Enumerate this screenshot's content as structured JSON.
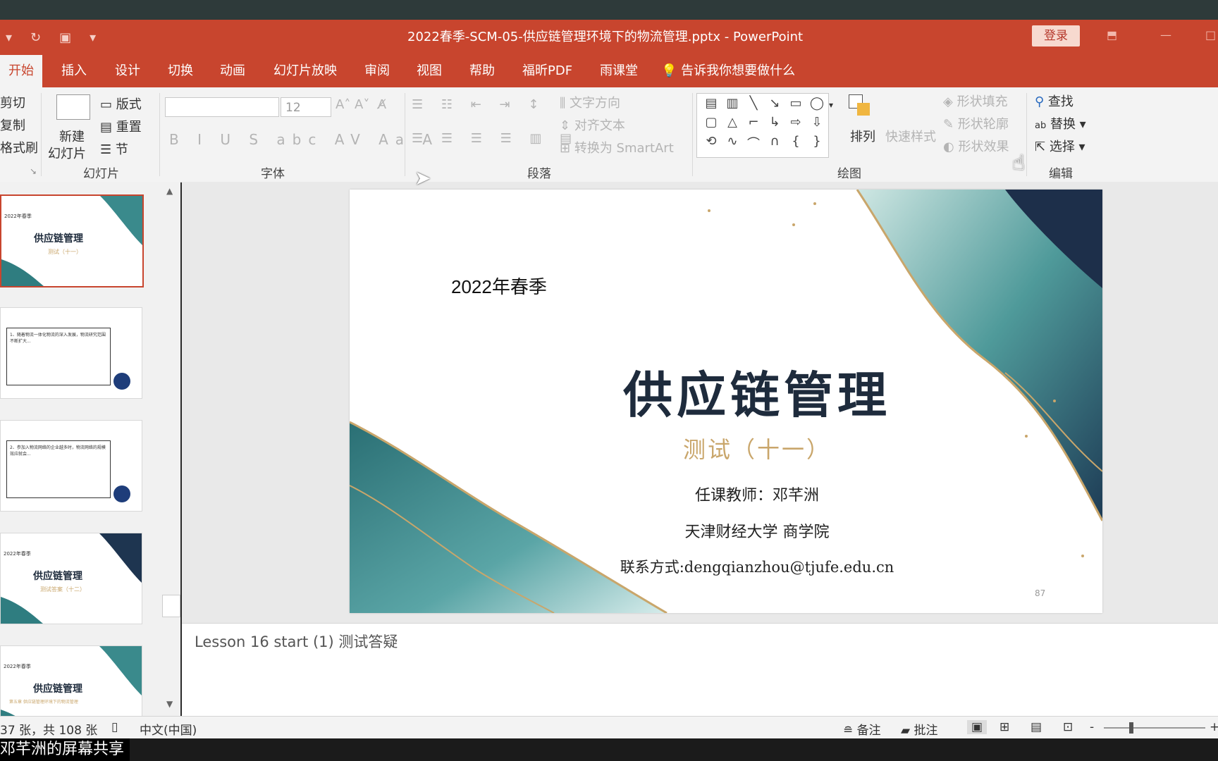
{
  "window": {
    "title": "2022春季-SCM-05-供应链管理环境下的物流管理.pptx  -  PowerPoint",
    "login_label": "登录"
  },
  "tabs": [
    "开始",
    "插入",
    "设计",
    "切换",
    "动画",
    "幻灯片放映",
    "审阅",
    "视图",
    "帮助",
    "福昕PDF",
    "雨课堂"
  ],
  "tellme": "告诉我你想要做什么",
  "ribbon": {
    "clipboard": {
      "cut": "剪切",
      "copy": "复制",
      "format_painter": "格式刷"
    },
    "slides": {
      "new_slide_1": "新建",
      "new_slide_2": "幻灯片",
      "layout": "版式",
      "reset": "重置",
      "section": "节",
      "group": "幻灯片"
    },
    "font": {
      "size": "12",
      "group": "字体"
    },
    "paragraph": {
      "text_direction": "文字方向",
      "align_text": "对齐文本",
      "smartart": "转换为 SmartArt",
      "group": "段落"
    },
    "drawing": {
      "arrange": "排列",
      "quick_styles": "快速样式",
      "shape_fill": "形状填充",
      "shape_outline": "形状轮廓",
      "shape_effects": "形状效果",
      "group": "绘图"
    },
    "editing": {
      "find": "查找",
      "replace": "替换",
      "select": "选择",
      "group": "编辑"
    }
  },
  "thumbnails": [
    {
      "season": "2022年春季",
      "title": "供应链管理",
      "sub": "测试（十一）"
    },
    {
      "text": "1、随着物流一体化物流的深入发展，物流研究范围不断扩大..."
    },
    {
      "text": "2、参加入物流网络的企业越多时，物流网络的规模效应就会..."
    },
    {
      "season": "2022年春季",
      "title": "供应链管理",
      "sub": "测试答案（十二）"
    },
    {
      "season": "2022年春季",
      "title": "供应链管理",
      "sub": "第五章 供应链管理环境下的物流管理"
    }
  ],
  "slide": {
    "season": "2022年春季",
    "title": "供应链管理",
    "subtitle": "测试（十一）",
    "teacher": "任课教师：邓芊洲",
    "school": "天津财经大学  商学院",
    "contact": "联系方式:dengqianzhou@tjufe.edu.cn",
    "page_number": "87"
  },
  "notes": "Lesson 16 start (1) 测试答疑",
  "status": {
    "slide_count": "37 张，共 108 张",
    "language": "中文(中国)",
    "notes_btn": "备注",
    "comments_btn": "批注",
    "zoom_minus": "-",
    "zoom_plus": "+"
  },
  "share_banner": "邓芊洲的屏幕共享",
  "colors": {
    "accent": "#c8452e",
    "title_navy": "#1e2b3c",
    "gold": "#c9a66b",
    "teal": "#2f7d80"
  }
}
